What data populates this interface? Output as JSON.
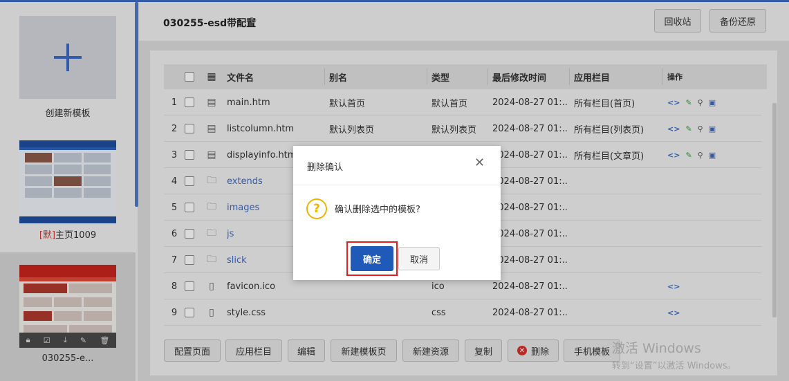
{
  "sidebar": {
    "create_label": "创建新模板",
    "template1": {
      "prefix": "[默]",
      "name": "主页1009"
    },
    "template2": {
      "name": "030255-e..."
    }
  },
  "header": {
    "title": "030255-esd带配置",
    "recycle_label": "回收站",
    "backup_label": "备份还原"
  },
  "table": {
    "columns": {
      "name": "文件名",
      "alias": "别名",
      "type": "类型",
      "modified": "最后修改时间",
      "column": "应用栏目",
      "ops": "操作"
    },
    "rows": [
      {
        "num": "1",
        "kind": "template",
        "name": "main.htm",
        "alias": "默认首页",
        "type": "默认首页",
        "time": "2024-08-27 01:...",
        "column": "所有栏目(首页)"
      },
      {
        "num": "2",
        "kind": "template",
        "name": "listcolumn.htm",
        "alias": "默认列表页",
        "type": "默认列表页",
        "time": "2024-08-27 01:...",
        "column": "所有栏目(列表页)"
      },
      {
        "num": "3",
        "kind": "template",
        "name": "displayinfo.htm",
        "alias": "",
        "type": "",
        "time": "2024-08-27 01:...",
        "column": "所有栏目(文章页)"
      },
      {
        "num": "4",
        "kind": "folder",
        "name": "extends",
        "alias": "",
        "type": "",
        "time": "2024-08-27 01:...",
        "column": ""
      },
      {
        "num": "5",
        "kind": "folder",
        "name": "images",
        "alias": "",
        "type": "",
        "time": "2024-08-27 01:...",
        "column": ""
      },
      {
        "num": "6",
        "kind": "folder",
        "name": "js",
        "alias": "",
        "type": "",
        "time": "2024-08-27 01:...",
        "column": ""
      },
      {
        "num": "7",
        "kind": "folder",
        "name": "slick",
        "alias": "",
        "type": "",
        "time": "2024-08-27 01:...",
        "column": ""
      },
      {
        "num": "8",
        "kind": "file",
        "name": "favicon.ico",
        "alias": "",
        "type": "ico",
        "time": "2024-08-27 01:...",
        "column": ""
      },
      {
        "num": "9",
        "kind": "file",
        "name": "style.css",
        "alias": "",
        "type": "css",
        "time": "2024-08-27 01:...",
        "column": ""
      }
    ]
  },
  "toolbar": {
    "config_page": "配置页面",
    "apply_column": "应用栏目",
    "edit": "编辑",
    "new_template": "新建模板页",
    "new_resource": "新建资源",
    "copy": "复制",
    "delete": "删除",
    "mobile_template": "手机模板"
  },
  "dialog": {
    "title": "删除确认",
    "message": "确认删除选中的模板?",
    "ok": "确定",
    "cancel": "取消"
  },
  "watermark": {
    "line1": "激活 Windows",
    "line2": "转到“设置”以激活 Windows。"
  }
}
